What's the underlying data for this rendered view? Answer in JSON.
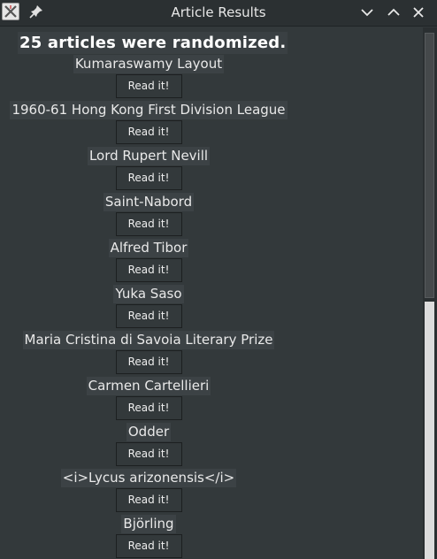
{
  "window": {
    "title": "Article Results",
    "icon": "x-app-icon",
    "pin_icon": "pin-icon",
    "controls": [
      "chevron-down-icon",
      "chevron-up-icon",
      "close-icon"
    ]
  },
  "header": {
    "summary": "25 articles were randomized."
  },
  "articles": [
    {
      "title": "Kumaraswamy Layout",
      "button": "Read it!"
    },
    {
      "title": "1960-61 Hong Kong First Division League",
      "button": "Read it!"
    },
    {
      "title": "Lord Rupert Nevill",
      "button": "Read it!"
    },
    {
      "title": "Saint-Nabord",
      "button": "Read it!"
    },
    {
      "title": "Alfred Tibor",
      "button": "Read it!"
    },
    {
      "title": "Yuka Saso",
      "button": "Read it!"
    },
    {
      "title": "Maria Cristina di Savoia Literary Prize",
      "button": "Read it!"
    },
    {
      "title": "Carmen Cartellieri",
      "button": "Read it!"
    },
    {
      "title": "Odder",
      "button": "Read it!"
    },
    {
      "title": "<i>Lycus arizonensis</i>",
      "button": "Read it!"
    },
    {
      "title": "Björling",
      "button": "Read it!"
    }
  ],
  "colors": {
    "background": "#33393b",
    "titlebar": "#2b3032",
    "text": "#e9e9e9"
  }
}
